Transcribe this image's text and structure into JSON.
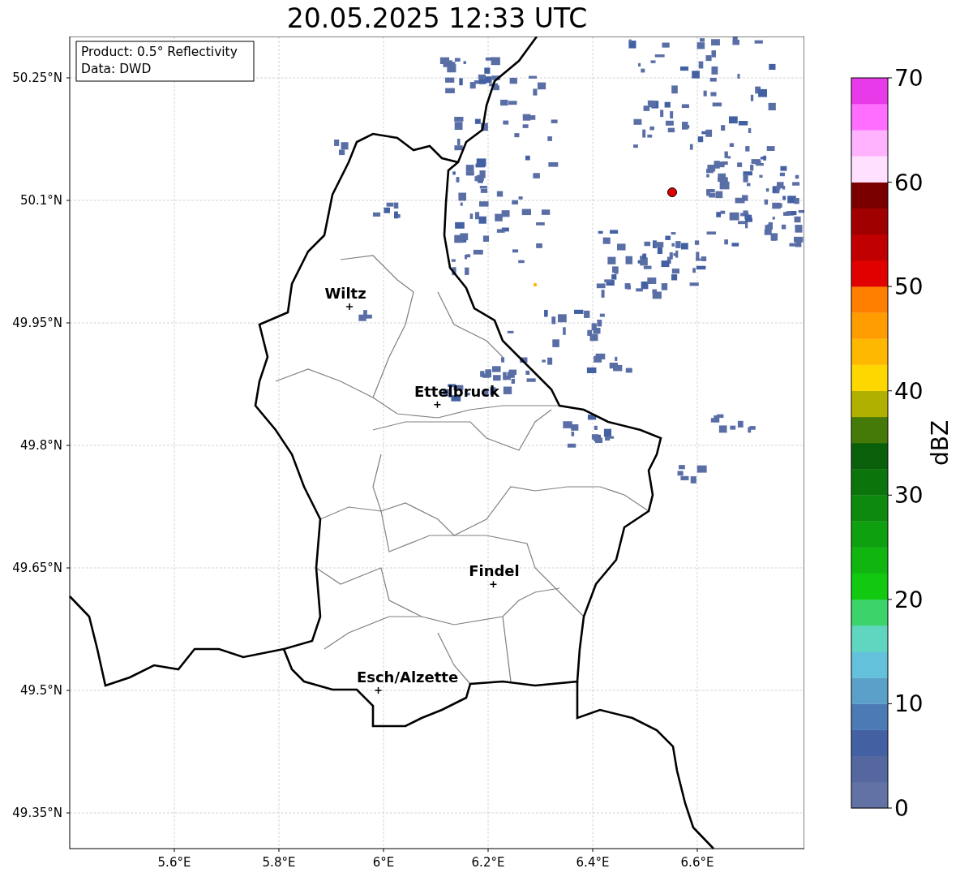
{
  "title": "20.05.2025 12:33 UTC",
  "info_box": {
    "lines": [
      "Product: 0.5° Reflectivity",
      "Data: DWD"
    ]
  },
  "map": {
    "lat_ticks": [
      "50.25°N",
      "50.1°N",
      "49.95°N",
      "49.8°N",
      "49.65°N",
      "49.5°N",
      "49.35°N"
    ],
    "lon_ticks": [
      "5.6°E",
      "5.8°E",
      "6°E",
      "6.2°E",
      "6.4°E",
      "6.6°E"
    ],
    "cities": [
      {
        "name": "Wiltz"
      },
      {
        "name": "Ettelbruck"
      },
      {
        "name": "Findel"
      },
      {
        "name": "Esch/Alzette"
      }
    ]
  },
  "colorbar": {
    "label": "dBZ",
    "ticks": [
      "70",
      "60",
      "50",
      "40",
      "30",
      "20",
      "10",
      "0"
    ],
    "bins": [
      {
        "color": "#6272a4"
      },
      {
        "color": "#55679f"
      },
      {
        "color": "#4360a3"
      },
      {
        "color": "#4b7ab5"
      },
      {
        "color": "#5ba0c9"
      },
      {
        "color": "#64c1dc"
      },
      {
        "color": "#60d6c0"
      },
      {
        "color": "#3dd36b"
      },
      {
        "color": "#12c912"
      },
      {
        "color": "#10b510"
      },
      {
        "color": "#0fa00f"
      },
      {
        "color": "#0d8a0d"
      },
      {
        "color": "#0b740b"
      },
      {
        "color": "#0a5f0a"
      },
      {
        "color": "#457a09"
      },
      {
        "color": "#b0b000"
      },
      {
        "color": "#ffd700"
      },
      {
        "color": "#ffb800"
      },
      {
        "color": "#ff9c00"
      },
      {
        "color": "#ff7f00"
      },
      {
        "color": "#e00000"
      },
      {
        "color": "#c00000"
      },
      {
        "color": "#a00000"
      },
      {
        "color": "#7a0000"
      },
      {
        "color": "#ffe0ff"
      },
      {
        "color": "#ffb3ff"
      },
      {
        "color": "#ff6eff"
      },
      {
        "color": "#e93ae9"
      }
    ]
  }
}
